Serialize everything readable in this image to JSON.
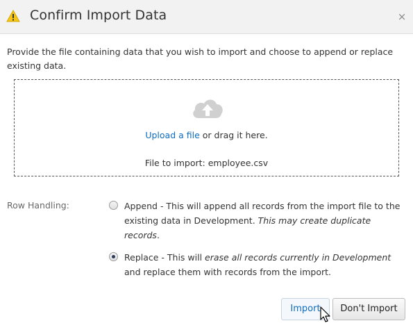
{
  "dialog": {
    "title": "Confirm Import Data",
    "close_glyph": "×",
    "description": "Provide the file containing data that you wish to import and choose to append or replace existing data."
  },
  "dropzone": {
    "upload_link": "Upload a file",
    "upload_suffix": " or drag it here.",
    "file_to_import": "File to import: employee.csv"
  },
  "row_handling": {
    "label": "Row Handling:",
    "append": {
      "text_a": "Append - This will append all records from the import file to the existing data in Development. ",
      "text_b_italic": "This may create duplicate records",
      "text_c": ".",
      "selected": false
    },
    "replace": {
      "text_a": "Replace - This will ",
      "text_b_italic": "erase all records currently in Development",
      "text_c": " and replace them with records from the import.",
      "selected": true
    }
  },
  "buttons": {
    "import": "Import",
    "dont_import": "Don't Import"
  },
  "icons": {
    "warning": "warning-icon",
    "close": "close-icon",
    "upload": "cloud-upload-icon",
    "cursor": "mouse-cursor-icon"
  },
  "colors": {
    "link": "#0f6cbd",
    "warning": "#f5c518",
    "header_bg": "#f2f2f2"
  }
}
